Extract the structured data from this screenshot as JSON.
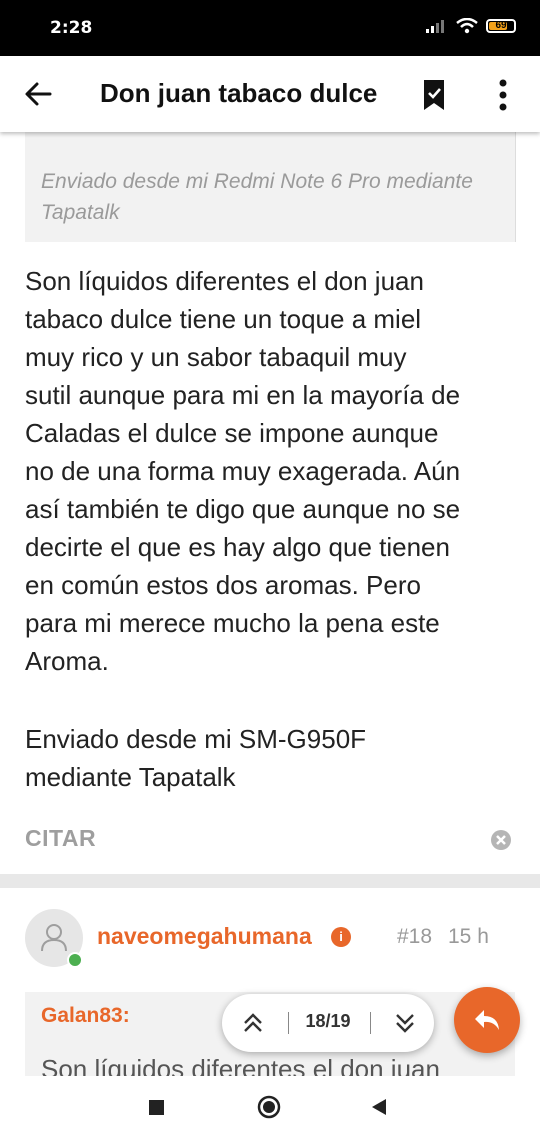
{
  "status_bar": {
    "time": "2:28",
    "battery": "69"
  },
  "app_bar": {
    "title": "Don juan tabaco dulce"
  },
  "post_prev": {
    "quote_signature": "Enviado desde mi Redmi Note 6 Pro mediante Tapatalk",
    "body_lines": [
      "Son líquidos diferentes el don juan",
      "tabaco dulce tiene un toque a miel",
      "muy rico y un sabor tabaquil muy",
      "sutil aunque para mi en la mayoría de",
      "Caladas el dulce se impone aunque",
      "no de una forma muy exagerada. Aún",
      "así también te digo que aunque no se",
      "decirte el que es hay algo que tienen",
      "en común estos dos aromas. Pero",
      "para mi merece mucho la pena este",
      "Aroma."
    ],
    "signature_lines": [
      "Enviado desde mi SM-G950F",
      "mediante Tapatalk"
    ],
    "cite_label": "CITAR"
  },
  "post_next": {
    "username": "naveomegahumana",
    "badge": "i",
    "post_number": "#18",
    "post_time": "15 h",
    "quote_author": "Galan83:",
    "quote_text": "Son líquidos diferentes el don juan"
  },
  "pager": {
    "label": "18/19"
  },
  "colors": {
    "accent": "#e8672a",
    "online": "#4caf50"
  },
  "icons": [
    "back-arrow-icon",
    "bookmark-icon",
    "more-vert-icon",
    "close-circle-icon",
    "user-icon",
    "chevron-double-up-icon",
    "chevron-double-down-icon",
    "reply-icon",
    "recents-icon",
    "home-icon",
    "back-triangle-icon"
  ]
}
